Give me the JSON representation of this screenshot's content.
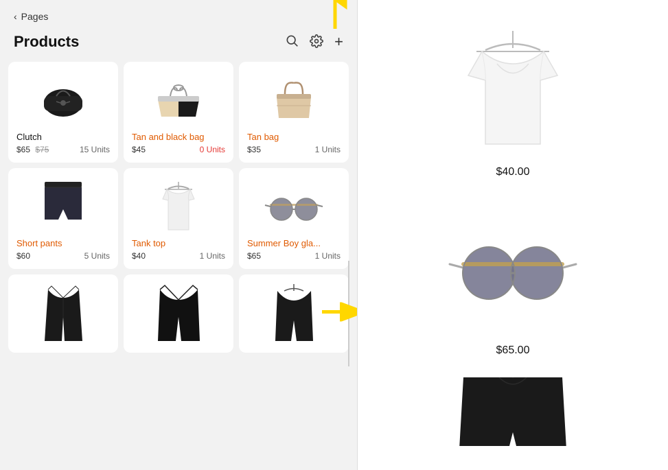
{
  "nav": {
    "back_label": "Pages"
  },
  "header": {
    "title": "Products",
    "search_icon": "⌕",
    "settings_icon": "⚙",
    "add_icon": "+"
  },
  "products": [
    {
      "name": "Clutch",
      "name_color": "black",
      "price": "$65",
      "price_strikethrough": "$75",
      "units": "15 Units",
      "units_color": "normal",
      "type": "clutch"
    },
    {
      "name": "Tan and black bag",
      "name_color": "orange",
      "price": "$45",
      "units": "0 Units",
      "units_color": "red",
      "type": "tan-black-bag"
    },
    {
      "name": "Tan bag",
      "name_color": "orange",
      "price": "$35",
      "units": "1 Units",
      "units_color": "normal",
      "type": "tan-bag"
    },
    {
      "name": "Short pants",
      "name_color": "orange",
      "price": "$60",
      "units": "5 Units",
      "units_color": "normal",
      "type": "pants"
    },
    {
      "name": "Tank top",
      "name_color": "orange",
      "price": "$40",
      "units": "1 Units",
      "units_color": "normal",
      "type": "tank-top"
    },
    {
      "name": "Summer Boy gla...",
      "name_color": "orange",
      "price": "$65",
      "units": "1 Units",
      "units_color": "normal",
      "type": "sunglasses"
    }
  ],
  "right_panel": {
    "items": [
      {
        "price": "$40.00",
        "type": "tank-top-white"
      },
      {
        "price": "$65.00",
        "type": "sunglasses"
      },
      {
        "type": "black-coat"
      }
    ]
  }
}
